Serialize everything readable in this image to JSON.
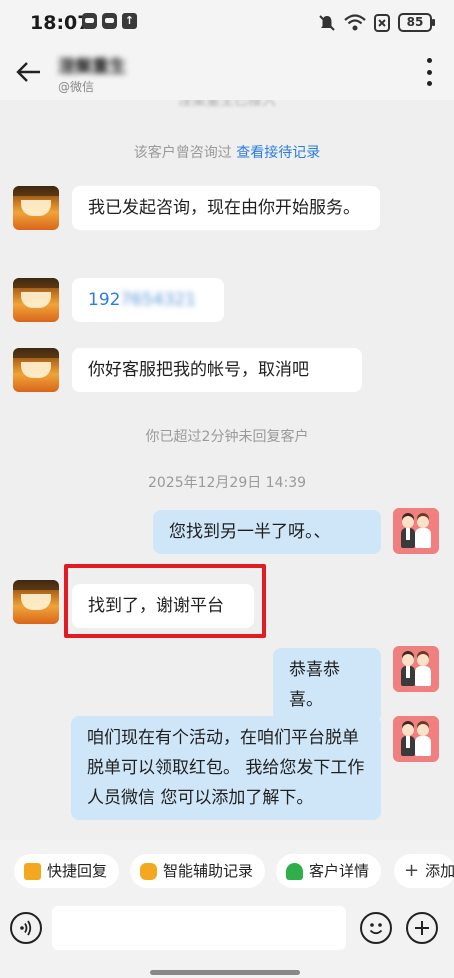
{
  "status_bar": {
    "time": "18:07",
    "battery": "85",
    "icons": [
      "app-notification-icon",
      "app-notification-icon",
      "upload-icon",
      "mute-icon",
      "wifi-icon",
      "close-box-icon"
    ]
  },
  "header": {
    "contact_name": "涅槃重生",
    "contact_sub": "@微信"
  },
  "chat": {
    "top_cut_notice": "涅槃重生已接入",
    "history_notice": "该客户曾咨询过",
    "history_link": "查看接待记录",
    "messages": [
      {
        "side": "left",
        "text": "我已发起咨询，现在由你开始服务。"
      },
      {
        "side": "left",
        "text_visible": "192",
        "text_blurred": "7654321"
      },
      {
        "side": "left",
        "text": "你好客服把我的帐号，取消吧"
      },
      {
        "side": "right",
        "text": "您找到另一半了呀。、"
      },
      {
        "side": "left",
        "text": "找到了，谢谢平台",
        "highlighted": true
      },
      {
        "side": "right",
        "text": "恭喜恭喜。"
      },
      {
        "side": "right",
        "text": "咱们现在有个活动，在咱们平台脱单脱单可以领取红包。 我给您发下工作人员微信 您可以添加了解下。"
      }
    ],
    "timeout_notice": "你已超过2分钟未回复客户",
    "timestamp": "2025年12月29日   14:39"
  },
  "quick_bar": {
    "items": [
      {
        "label": "快捷回复",
        "icon": "quick-reply-icon"
      },
      {
        "label": "智能辅助记录",
        "icon": "smart-assist-icon"
      },
      {
        "label": "客户详情",
        "icon": "customer-detail-icon"
      },
      {
        "label": "添加",
        "icon": "plus-icon"
      }
    ]
  },
  "input_bar": {
    "placeholder": ""
  }
}
